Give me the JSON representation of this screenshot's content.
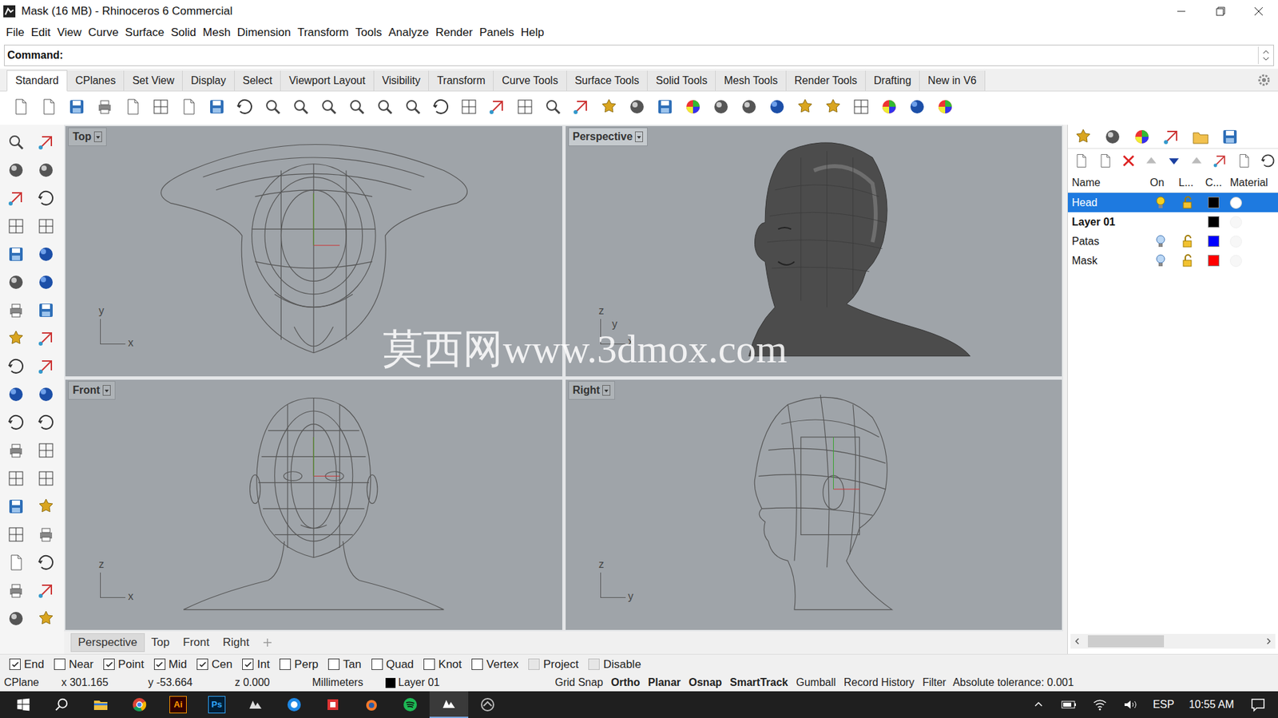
{
  "window": {
    "title": "Mask (16 MB) - Rhinoceros 6 Commercial"
  },
  "menu": [
    "File",
    "Edit",
    "View",
    "Curve",
    "Surface",
    "Solid",
    "Mesh",
    "Dimension",
    "Transform",
    "Tools",
    "Analyze",
    "Render",
    "Panels",
    "Help"
  ],
  "command": {
    "label": "Command:",
    "value": ""
  },
  "toolbar_tabs": [
    {
      "label": "Standard",
      "selected": true
    },
    {
      "label": "CPlanes",
      "selected": false
    },
    {
      "label": "Set View",
      "selected": false
    },
    {
      "label": "Display",
      "selected": false
    },
    {
      "label": "Select",
      "selected": false
    },
    {
      "label": "Viewport Layout",
      "selected": false
    },
    {
      "label": "Visibility",
      "selected": false
    },
    {
      "label": "Transform",
      "selected": false
    },
    {
      "label": "Curve Tools",
      "selected": false
    },
    {
      "label": "Surface Tools",
      "selected": false
    },
    {
      "label": "Solid Tools",
      "selected": false
    },
    {
      "label": "Mesh Tools",
      "selected": false
    },
    {
      "label": "Render Tools",
      "selected": false
    },
    {
      "label": "Drafting",
      "selected": false
    },
    {
      "label": "New in V6",
      "selected": false
    }
  ],
  "viewports": [
    {
      "label": "Top",
      "active": false,
      "axes": [
        "y",
        "x"
      ]
    },
    {
      "label": "Perspective",
      "active": true,
      "axes": [
        "z",
        "y",
        "x"
      ]
    },
    {
      "label": "Front",
      "active": false,
      "axes": [
        "z",
        "x"
      ]
    },
    {
      "label": "Right",
      "active": false,
      "axes": [
        "z",
        "y"
      ]
    }
  ],
  "watermark": "莫西网www.3dmox.com",
  "viewport_tabs": [
    {
      "label": "Perspective",
      "selected": true
    },
    {
      "label": "Top",
      "selected": false
    },
    {
      "label": "Front",
      "selected": false
    },
    {
      "label": "Right",
      "selected": false
    }
  ],
  "layers": {
    "columns": [
      "Name",
      "On",
      "L...",
      "C...",
      "Material"
    ],
    "rows": [
      {
        "name": "Head",
        "kind": "layer",
        "selected": true,
        "on": true,
        "locked": false,
        "color": "#000000",
        "material": true
      },
      {
        "name": "Layer 01",
        "kind": "header",
        "selected": false,
        "color": "#000000",
        "material": false
      },
      {
        "name": "Patas",
        "kind": "layer",
        "selected": false,
        "on": true,
        "locked": false,
        "color": "#0000ff",
        "material": false
      },
      {
        "name": "Mask",
        "kind": "layer",
        "selected": false,
        "on": true,
        "locked": false,
        "color": "#ff0000",
        "material": false
      }
    ]
  },
  "osnaps": [
    {
      "label": "End",
      "checked": true,
      "disabled": false
    },
    {
      "label": "Near",
      "checked": false,
      "disabled": false
    },
    {
      "label": "Point",
      "checked": true,
      "disabled": false
    },
    {
      "label": "Mid",
      "checked": true,
      "disabled": false
    },
    {
      "label": "Cen",
      "checked": true,
      "disabled": false
    },
    {
      "label": "Int",
      "checked": true,
      "disabled": false
    },
    {
      "label": "Perp",
      "checked": false,
      "disabled": false
    },
    {
      "label": "Tan",
      "checked": false,
      "disabled": false
    },
    {
      "label": "Quad",
      "checked": false,
      "disabled": false
    },
    {
      "label": "Knot",
      "checked": false,
      "disabled": false
    },
    {
      "label": "Vertex",
      "checked": false,
      "disabled": false
    },
    {
      "label": "Project",
      "checked": false,
      "disabled": true
    },
    {
      "label": "Disable",
      "checked": false,
      "disabled": true
    }
  ],
  "status_bar": {
    "cplane": "CPlane",
    "x": "x 301.165",
    "y": "y -53.664",
    "z": "z 0.000",
    "units": "Millimeters",
    "layer": {
      "name": "Layer 01",
      "color": "#000000"
    },
    "toggles": [
      {
        "label": "Grid Snap",
        "on": false
      },
      {
        "label": "Ortho",
        "on": true
      },
      {
        "label": "Planar",
        "on": true
      },
      {
        "label": "Osnap",
        "on": true
      },
      {
        "label": "SmartTrack",
        "on": true
      },
      {
        "label": "Gumball",
        "on": false
      },
      {
        "label": "Record History",
        "on": false
      },
      {
        "label": "Filter",
        "on": false
      }
    ],
    "tolerance": "Absolute tolerance: 0.001"
  },
  "taskbar": {
    "app_labels": [
      "Ai",
      "Ps"
    ],
    "language": "ESP",
    "time": "10:55 AM"
  }
}
